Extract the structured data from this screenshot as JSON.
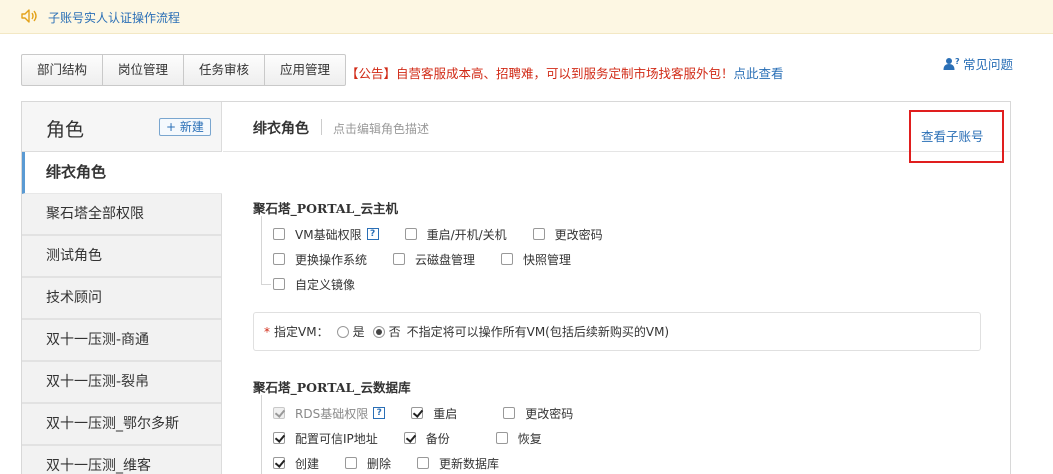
{
  "notice": {
    "text": "子账号实人认证操作流程"
  },
  "tabs": [
    "部门结构",
    "岗位管理",
    "任务审核",
    "应用管理"
  ],
  "announcement": {
    "prefix": "【公告】自营客服成本高、招聘难，可以到服务定制市场找客服外包！",
    "link": "点此查看"
  },
  "faq": {
    "label": "常见问题"
  },
  "sidebar": {
    "title": "角色",
    "new_button": "+ 新建",
    "roles": [
      "绯衣角色",
      "聚石塔全部权限",
      "测试角色",
      "技术顾问",
      "双十一压测-商通",
      "双十一压测-裂帛",
      "双十一压测_鄂尔多斯",
      "双十一压测_维客"
    ],
    "active_index": 0
  },
  "main": {
    "role_name": "绯衣角色",
    "role_desc_placeholder": "点击编辑角色描述",
    "view_subaccount": "查看子账号"
  },
  "sections": {
    "cloud_host": {
      "title": "聚石塔_PORTAL_云主机",
      "perms": [
        {
          "label": "VM基础权限",
          "checked": false
        },
        {
          "label": "重启/开机/关机",
          "checked": false
        },
        {
          "label": "更改密码",
          "checked": false
        },
        {
          "label": "更换操作系统",
          "checked": false
        },
        {
          "label": "云磁盘管理",
          "checked": false
        },
        {
          "label": "快照管理",
          "checked": false
        },
        {
          "label": "自定义镜像",
          "checked": false
        }
      ],
      "vm_label": "指定VM：",
      "vm_yes": "是",
      "vm_no": "否",
      "vm_note": "不指定将可以操作所有VM(包括后续新购买的VM)",
      "vm_selected": "否"
    },
    "cloud_db": {
      "title": "聚石塔_PORTAL_云数据库",
      "perms": [
        {
          "label": "RDS基础权限",
          "checked": true,
          "disabled": true
        },
        {
          "label": "重启",
          "checked": true
        },
        {
          "label": "更改密码",
          "checked": false
        },
        {
          "label": "配置可信IP地址",
          "checked": true
        },
        {
          "label": "备份",
          "checked": true
        },
        {
          "label": "恢复",
          "checked": false
        },
        {
          "label": "创建",
          "checked": true
        },
        {
          "label": "删除",
          "checked": false
        },
        {
          "label": "更新数据库",
          "checked": false
        }
      ]
    }
  },
  "help_mark": "?",
  "colors": {
    "link": "#2a6fb6",
    "alert": "#d12a16",
    "highlight_box": "#e01e1e",
    "notice_bg": "#fdf7e3"
  }
}
